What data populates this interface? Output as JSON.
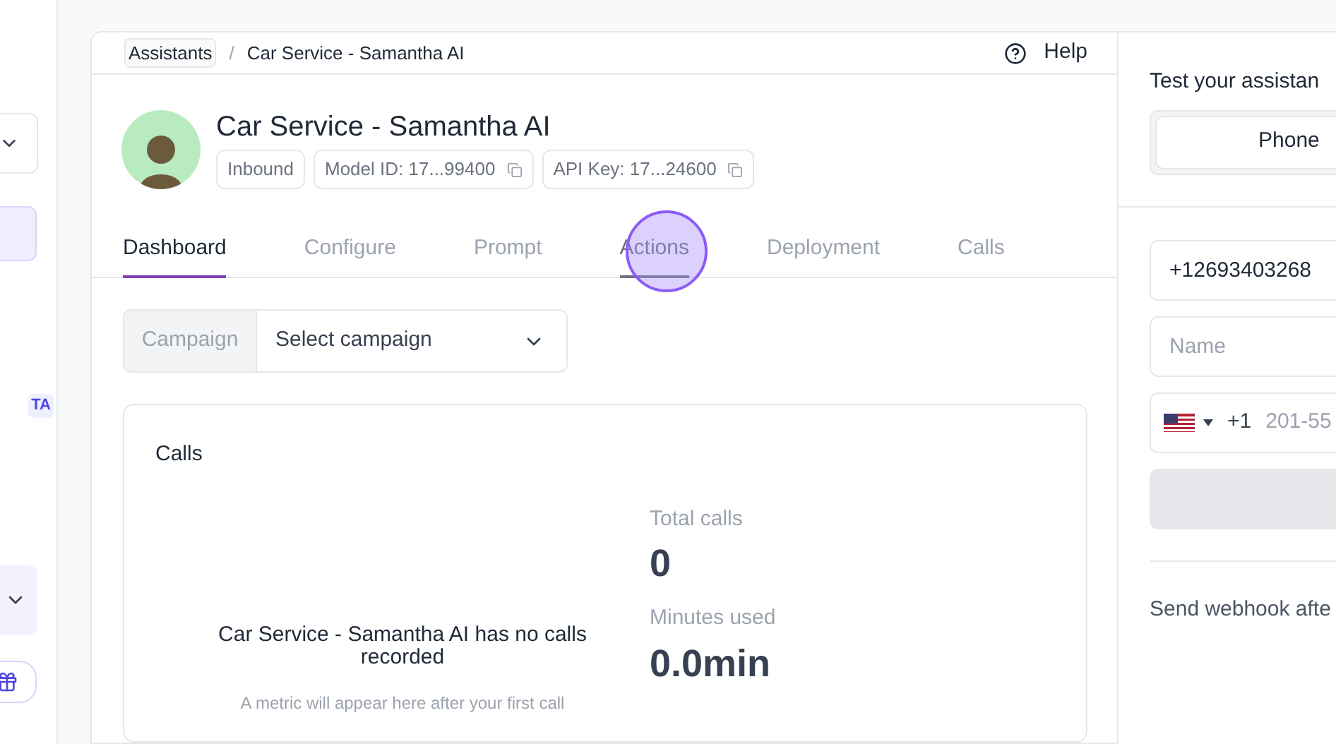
{
  "sidebar": {
    "badge": "TA"
  },
  "breadcrumb": [
    "Assistants",
    "Car Service - Samantha AI"
  ],
  "breadcrumb_separator": "/",
  "help": "Help",
  "assistant": {
    "name": "Car Service - Samantha AI",
    "tags": [
      {
        "label": "Inbound",
        "copy": false
      },
      {
        "label": "Model ID: 17...99400",
        "copy": true
      },
      {
        "label": "API Key: 17...24600",
        "copy": true
      }
    ]
  },
  "tabs": [
    {
      "label": "Dashboard",
      "selected": true,
      "hovered": false
    },
    {
      "label": "Configure",
      "selected": false,
      "hovered": false
    },
    {
      "label": "Prompt",
      "selected": false,
      "hovered": false
    },
    {
      "label": "Actions",
      "selected": false,
      "hovered": true
    },
    {
      "label": "Deployment",
      "selected": false,
      "hovered": false
    },
    {
      "label": "Calls",
      "selected": false,
      "hovered": false
    }
  ],
  "campaign": {
    "label": "Campaign",
    "placeholder": "Select campaign"
  },
  "calls": {
    "title": "Calls",
    "empty_title": "Car Service - Samantha AI has no calls recorded",
    "empty_text": "A metric will appear here after your first call",
    "stats": [
      {
        "label": "Total calls",
        "value": "0"
      },
      {
        "label": "Minutes used",
        "value": "0.0min"
      }
    ]
  },
  "test_panel": {
    "title": "Test your assistan",
    "modes": [
      {
        "label": "Phone",
        "selected": true
      }
    ],
    "phone_value": "+12693403268",
    "name_placeholder": "Name",
    "dial_code": "+1",
    "number_placeholder": "201-55",
    "webhook": "Send webhook afte"
  }
}
